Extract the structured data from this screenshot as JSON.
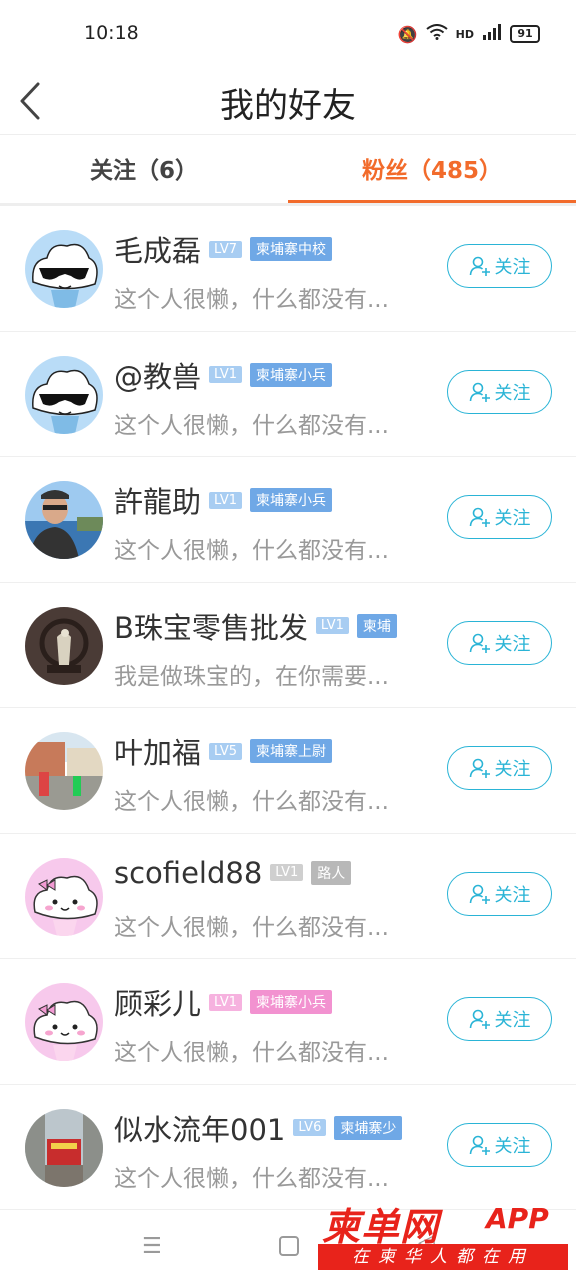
{
  "status_bar": {
    "time": "10:18",
    "network": "HD",
    "battery": "91"
  },
  "header": {
    "title": "我的好友"
  },
  "tabs": [
    {
      "label": "关注（6）",
      "active": false
    },
    {
      "label": "粉丝（485）",
      "active": true
    }
  ],
  "accent_color": "#f26b2b",
  "follow_color": "#2ab4d6",
  "follow_label": "关注",
  "fans": [
    {
      "name": "毛成磊",
      "level": "LV7",
      "title": "柬埔寨中校",
      "bio": "这个人很懒，什么都没有...",
      "avatar": "cloud-sunglasses"
    },
    {
      "name": "@教兽",
      "level": "LV1",
      "title": "柬埔寨小兵",
      "bio": "这个人很懒，什么都没有...",
      "avatar": "cloud-sunglasses"
    },
    {
      "name": "許龍助",
      "level": "LV1",
      "title": "柬埔寨小兵",
      "bio": "这个人很懒，什么都没有...",
      "avatar": "photo-man-sea"
    },
    {
      "name": "B珠宝零售批发",
      "level": "LV1",
      "title": "柬埔",
      "bio": "我是做珠宝的，在你需要...",
      "avatar": "photo-jewelry"
    },
    {
      "name": "叶加福",
      "level": "LV5",
      "title": "柬埔寨上尉",
      "bio": "这个人很懒，什么都没有...",
      "avatar": "photo-street"
    },
    {
      "name": "scofield88",
      "level": "LV1",
      "title": "路人",
      "bio": "这个人很懒，什么都没有...",
      "avatar": "cloud-pink-bow"
    },
    {
      "name": "顾彩儿",
      "level": "LV1",
      "title": "柬埔寨小兵",
      "bio": "这个人很懒，什么都没有...",
      "avatar": "cloud-pink-bow"
    },
    {
      "name": "似水流年001",
      "level": "LV6",
      "title": "柬埔寨少",
      "bio": "这个人很懒，什么都没有...",
      "avatar": "photo-school-gate"
    }
  ],
  "watermark": {
    "logo": "柬单网",
    "app": "APP",
    "slogan": "在柬华人都在用"
  }
}
